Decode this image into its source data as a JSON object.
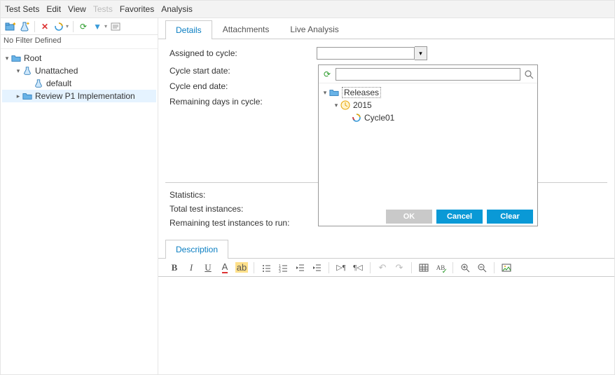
{
  "menubar": {
    "test_sets": "Test Sets",
    "edit": "Edit",
    "view": "View",
    "tests": "Tests",
    "favorites": "Favorites",
    "analysis": "Analysis"
  },
  "left": {
    "filter_status": "No Filter Defined",
    "nodes": {
      "root": "Root",
      "unattached": "Unattached",
      "default": "default",
      "review_p1": "Review P1 Implementation"
    }
  },
  "tabs": {
    "details": "Details",
    "attachments": "Attachments",
    "live_analysis": "Live Analysis"
  },
  "form": {
    "assigned_to_cycle": "Assigned to cycle:",
    "cycle_start_date": "Cycle start date:",
    "cycle_end_date": "Cycle end date:",
    "remaining_days": "Remaining days in cycle:"
  },
  "popup": {
    "search_placeholder": "",
    "releases": "Releases",
    "year": "2015",
    "cycle": "Cycle01",
    "ok": "OK",
    "cancel": "Cancel",
    "clear": "Clear"
  },
  "stats": {
    "statistics": "Statistics:",
    "total_instances": "Total test instances:",
    "remaining_instances": "Remaining test instances to run:"
  },
  "desc_tab": "Description"
}
